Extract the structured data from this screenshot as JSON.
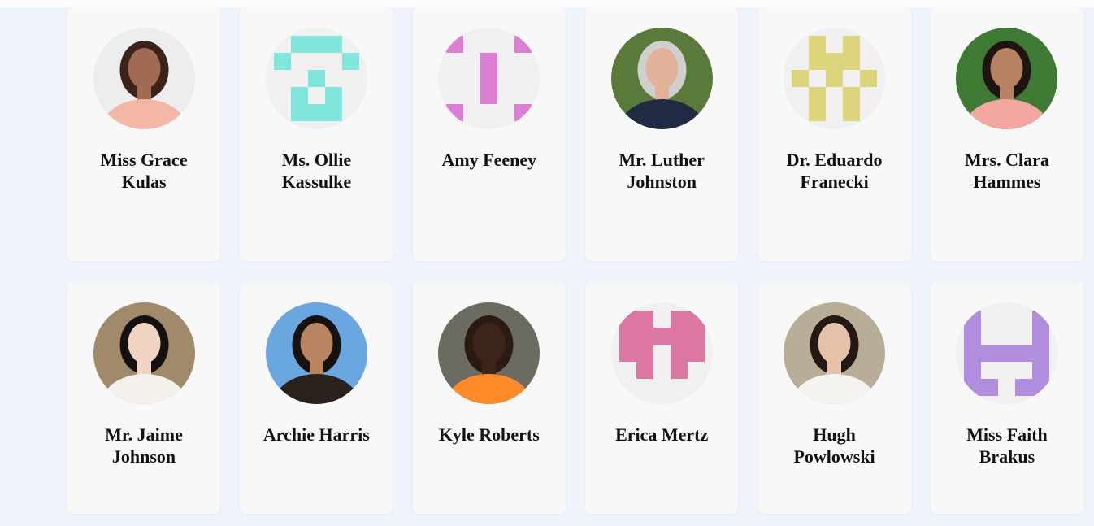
{
  "team": {
    "members": [
      {
        "name": "Miss Grace Kulas",
        "avatar": {
          "kind": "photo",
          "icon": "woman-photo-icon",
          "bg": "#ededed",
          "skin": "#a06b52",
          "hair": "#3a2318",
          "shirt": "#f4b7a6"
        }
      },
      {
        "name": "Ms. Ollie Kassulke",
        "avatar": {
          "kind": "identicon",
          "icon": "identicon-icon",
          "color": "#80e5da"
        }
      },
      {
        "name": "Amy Feeney",
        "avatar": {
          "kind": "identicon",
          "icon": "identicon-icon",
          "color": "#dd7ed4"
        }
      },
      {
        "name": "Mr. Luther Johnston",
        "avatar": {
          "kind": "photo",
          "icon": "man-photo-icon",
          "bg": "#5a7a3a",
          "skin": "#e2b19a",
          "hair": "#cfcfcf",
          "shirt": "#1f2a44"
        }
      },
      {
        "name": "Dr. Eduardo Franecki",
        "avatar": {
          "kind": "identicon",
          "icon": "identicon-icon",
          "color": "#dcd47a"
        }
      },
      {
        "name": "Mrs. Clara Hammes",
        "avatar": {
          "kind": "photo",
          "icon": "woman-photo-icon",
          "bg": "#3f7a34",
          "skin": "#b78261",
          "hair": "#1e1512",
          "shirt": "#f4a7a0"
        }
      },
      {
        "name": "Mr. Jaime Johnson",
        "avatar": {
          "kind": "photo",
          "icon": "woman-photo-icon",
          "bg": "#a08a6a",
          "skin": "#f1d3c2",
          "hair": "#141210",
          "shirt": "#f4f1ec"
        }
      },
      {
        "name": "Archie Harris",
        "avatar": {
          "kind": "photo",
          "icon": "woman-photo-icon",
          "bg": "#6aa7e0",
          "skin": "#b98560",
          "hair": "#171210",
          "shirt": "#2a211c"
        }
      },
      {
        "name": "Kyle Roberts",
        "avatar": {
          "kind": "photo",
          "icon": "man-photo-icon",
          "bg": "#6b6b62",
          "skin": "#3c2418",
          "hair": "#2a1a12",
          "shirt": "#ff8a2a"
        }
      },
      {
        "name": "Erica Mertz",
        "avatar": {
          "kind": "identicon",
          "icon": "identicon-icon",
          "color": "#dc76a2"
        }
      },
      {
        "name": "Hugh Powlowski",
        "avatar": {
          "kind": "photo",
          "icon": "woman-photo-icon",
          "bg": "#b9ad98",
          "skin": "#e6c1aa",
          "hair": "#231814",
          "shirt": "#f5f3ef"
        }
      },
      {
        "name": "Miss Faith Brakus",
        "avatar": {
          "kind": "identicon",
          "icon": "identicon-icon",
          "color": "#b18ddd"
        }
      }
    ]
  }
}
